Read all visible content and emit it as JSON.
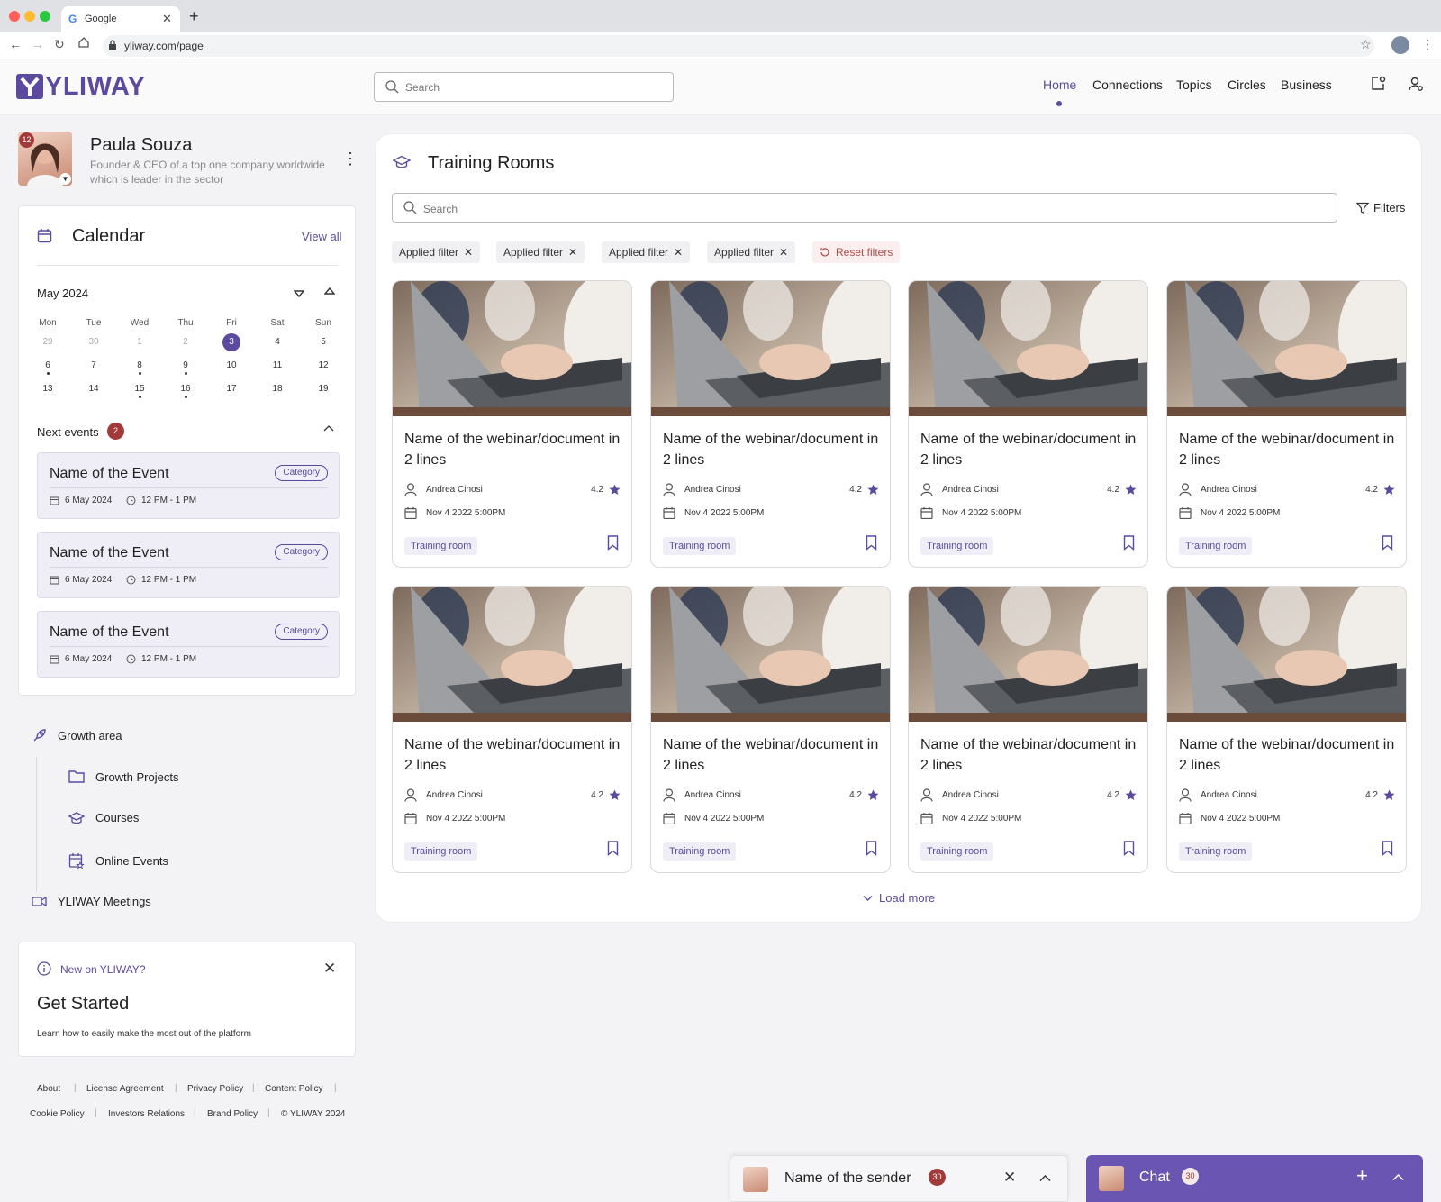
{
  "browser": {
    "tab_title": "Google",
    "url": "yliway.com/page"
  },
  "header": {
    "logo_text": "YLIWAY",
    "search_placeholder": "Search",
    "nav": [
      {
        "label": "Home",
        "active": true
      },
      {
        "label": "Connections",
        "active": false
      },
      {
        "label": "Topics",
        "active": false
      },
      {
        "label": "Circles",
        "active": false
      },
      {
        "label": "Business",
        "active": false
      }
    ]
  },
  "profile": {
    "name": "Paula Souza",
    "description": "Founder & CEO of a top one company worldwide which is leader in the sector",
    "notification_count": "12"
  },
  "calendar": {
    "title": "Calendar",
    "view_all": "View all",
    "month_label": "May 2024",
    "weekdays": [
      "Mon",
      "Tue",
      "Wed",
      "Thu",
      "Fri",
      "Sat",
      "Sun"
    ],
    "weeks": [
      [
        "29",
        "30",
        "1",
        "2",
        "3",
        "4",
        "5"
      ],
      [
        "6",
        "7",
        "8",
        "9",
        "10",
        "11",
        "12"
      ],
      [
        "13",
        "14",
        "15",
        "16",
        "17",
        "18",
        "19"
      ]
    ],
    "selected_day": "3",
    "next_events_label": "Next events",
    "next_events_count": "2",
    "events": [
      {
        "title": "Name of the Event",
        "category": "Category",
        "date": "6 May 2024",
        "time": "12 PM - 1 PM"
      },
      {
        "title": "Name of the Event",
        "category": "Category",
        "date": "6 May 2024",
        "time": "12 PM - 1 PM"
      },
      {
        "title": "Name of the Event",
        "category": "Category",
        "date": "6 May 2024",
        "time": "12 PM - 1 PM"
      }
    ]
  },
  "sidebar_menu": {
    "growth_area": "Growth area",
    "growth_projects": "Growth Projects",
    "courses": "Courses",
    "online_events": "Online Events",
    "meetings": "YLIWAY Meetings"
  },
  "get_started": {
    "label": "New on YLIWAY?",
    "title": "Get Started",
    "text": "Learn how to easily make the most out of the platform"
  },
  "footer": {
    "row1": [
      "About",
      "License Agreement",
      "Privacy Policy",
      "Content Policy"
    ],
    "row2": [
      "Cookie Policy",
      "Investors Relations",
      "Brand Policy",
      "© YLIWAY 2024"
    ]
  },
  "training": {
    "title": "Training Rooms",
    "search_placeholder": "Search",
    "filters_label": "Filters",
    "applied_filters": [
      "Applied filter",
      "Applied filter",
      "Applied filter",
      "Applied filter"
    ],
    "reset_label": "Reset filters",
    "cards": [
      {
        "title": "Name of the webinar/document in 2 lines",
        "author": "Andrea Cinosi",
        "rating": "4.2",
        "date": "Nov 4 2022 5:00PM",
        "tag": "Training room"
      },
      {
        "title": "Name of the webinar/document in 2 lines",
        "author": "Andrea Cinosi",
        "rating": "4.2",
        "date": "Nov 4 2022 5:00PM",
        "tag": "Training room"
      },
      {
        "title": "Name of the webinar/document in 2 lines",
        "author": "Andrea Cinosi",
        "rating": "4.2",
        "date": "Nov 4 2022 5:00PM",
        "tag": "Training room"
      },
      {
        "title": "Name of the webinar/document in 2 lines",
        "author": "Andrea Cinosi",
        "rating": "4.2",
        "date": "Nov 4 2022 5:00PM",
        "tag": "Training room"
      },
      {
        "title": "Name of the webinar/document in 2 lines",
        "author": "Andrea Cinosi",
        "rating": "4.2",
        "date": "Nov 4 2022 5:00PM",
        "tag": "Training room"
      },
      {
        "title": "Name of the webinar/document in 2 lines",
        "author": "Andrea Cinosi",
        "rating": "4.2",
        "date": "Nov 4 2022 5:00PM",
        "tag": "Training room"
      },
      {
        "title": "Name of the webinar/document in 2 lines",
        "author": "Andrea Cinosi",
        "rating": "4.2",
        "date": "Nov 4 2022 5:00PM",
        "tag": "Training room"
      },
      {
        "title": "Name of the webinar/document in 2 lines",
        "author": "Andrea Cinosi",
        "rating": "4.2",
        "date": "Nov 4 2022 5:00PM",
        "tag": "Training room"
      }
    ],
    "load_more": "Load more"
  },
  "chat": {
    "sender_label": "Name of the sender",
    "sender_count": "30",
    "chat_label": "Chat",
    "chat_count": "30"
  },
  "colors": {
    "brand": "#5b4a9e",
    "badge": "#a33a3a",
    "star": "#5b4a9e"
  }
}
